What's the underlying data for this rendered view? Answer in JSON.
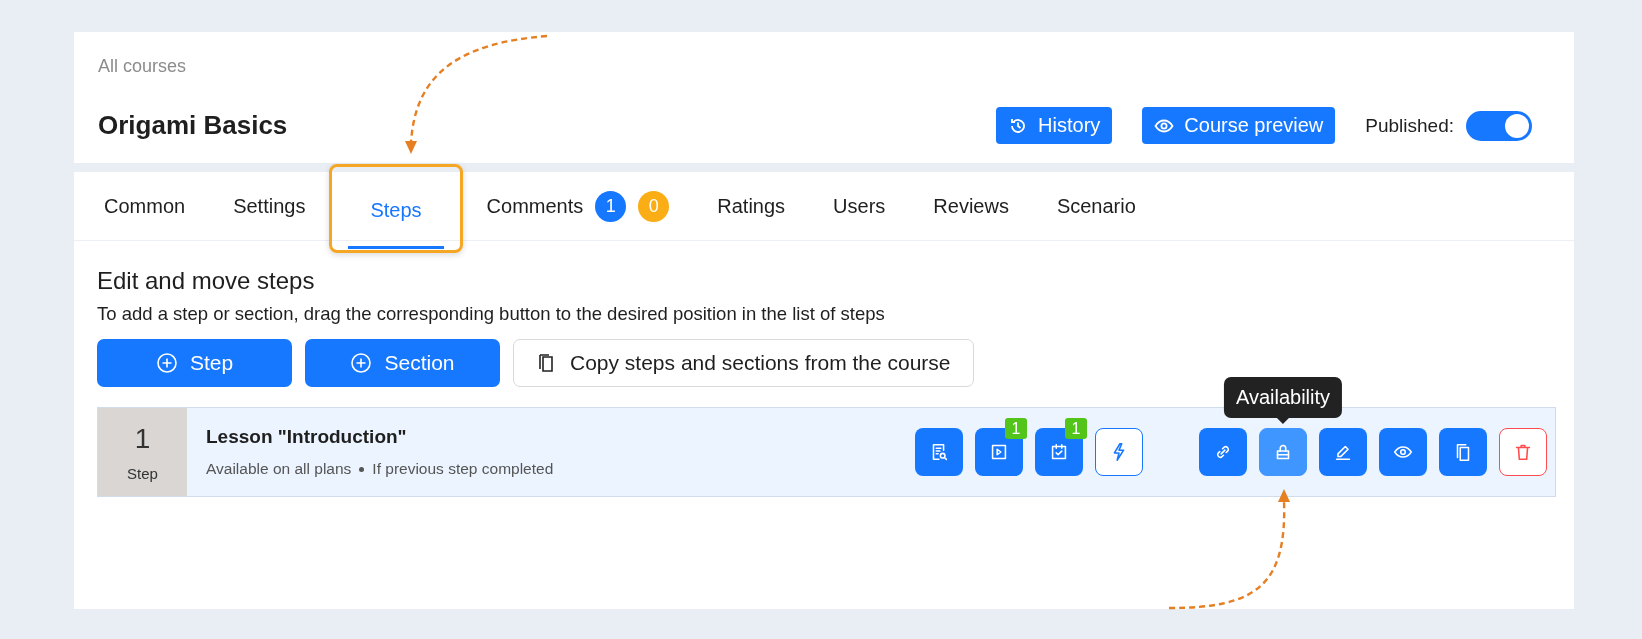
{
  "breadcrumb": "All courses",
  "title": "Origami Basics",
  "header_buttons": [
    {
      "kind": "history",
      "label": "History"
    },
    {
      "kind": "preview",
      "label": "Course preview"
    }
  ],
  "published": {
    "label": "Published:",
    "on": true
  },
  "tabs": [
    {
      "label": "Common",
      "selected": false,
      "highlighted": false
    },
    {
      "label": "Settings",
      "selected": false,
      "highlighted": false
    },
    {
      "label": "Steps",
      "selected": true,
      "highlighted": true
    },
    {
      "label": "Comments",
      "selected": false,
      "highlighted": false,
      "badges": [
        {
          "text": "1",
          "color": "#1677ff"
        },
        {
          "text": "0",
          "color": "#faad14"
        }
      ]
    },
    {
      "label": "Ratings",
      "selected": false,
      "highlighted": false
    },
    {
      "label": "Users",
      "selected": false,
      "highlighted": false
    },
    {
      "label": "Reviews",
      "selected": false,
      "highlighted": false
    },
    {
      "label": "Scenario",
      "selected": false,
      "highlighted": false
    }
  ],
  "section_title": "Edit and move steps",
  "hint": "To add a step or section, drag the corresponding button to the desired position in the list of steps",
  "add_buttons": [
    {
      "kind": "step",
      "label": "Step"
    },
    {
      "kind": "section",
      "label": "Section"
    },
    {
      "kind": "copy",
      "label": "Copy steps and sections from the course"
    }
  ],
  "steps": [
    {
      "number": "1",
      "number_label": "Step",
      "title": "Lesson \"Introduction\"",
      "details": [
        "Available on all plans",
        "If previous step completed"
      ],
      "actions": [
        {
          "kind": "preview",
          "hovered": false
        },
        {
          "kind": "video",
          "hovered": false,
          "badge": "1"
        },
        {
          "kind": "task",
          "hovered": false,
          "badge": "1"
        },
        {
          "kind": "trigger",
          "hovered": false
        },
        {
          "kind": "link",
          "hovered": false
        },
        {
          "kind": "availability",
          "hovered": true,
          "tooltip": "Availability"
        },
        {
          "kind": "edit",
          "hovered": false
        },
        {
          "kind": "view",
          "hovered": false
        },
        {
          "kind": "copy",
          "hovered": false
        },
        {
          "kind": "delete",
          "hovered": false
        }
      ]
    }
  ]
}
